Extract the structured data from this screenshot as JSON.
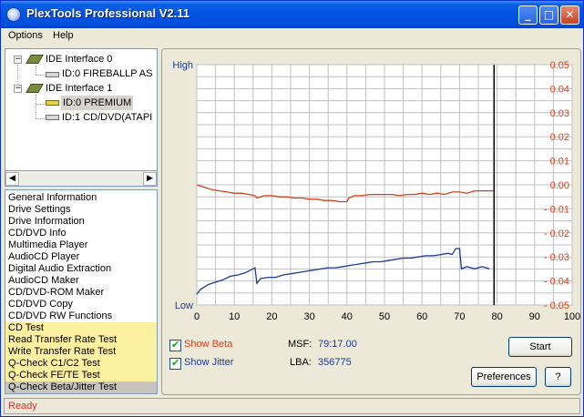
{
  "window": {
    "title": "PlexTools Professional V2.11",
    "minimize": "_",
    "maximize": "□",
    "close": "✕"
  },
  "menu": {
    "items": [
      "Options",
      "Help"
    ]
  },
  "tree": {
    "interfaces": [
      {
        "label": "IDE Interface 0",
        "expander": "−",
        "devices": [
          {
            "label": "ID:0  FIREBALLP AS"
          }
        ]
      },
      {
        "label": "IDE Interface 1",
        "expander": "−",
        "devices": [
          {
            "label": "ID:0  PREMIUM",
            "selected": true
          },
          {
            "label": "ID:1  CD/DVD(ATAPI"
          }
        ]
      }
    ],
    "scroll_left": "◀",
    "scroll_right": "▶"
  },
  "functions": {
    "items": [
      "General Information",
      "Drive Settings",
      "Drive Information",
      "CD/DVD Info",
      "Multimedia Player",
      "AudioCD Player",
      "Digital Audio Extraction",
      "AudioCD Maker",
      "CD/DVD-ROM Maker",
      "CD/DVD Copy",
      "CD/DVD RW Functions",
      "CD Test",
      "Read Transfer Rate Test",
      "Write Transfer Rate Test",
      "Q-Check C1/C2 Test",
      "Q-Check FE/TE Test",
      "Q-Check Beta/Jitter Test"
    ],
    "highlighted_from": 11,
    "selected_index": 16
  },
  "chart_data": {
    "type": "line",
    "left_axis": {
      "top_label": "High",
      "bottom_label": "Low"
    },
    "x_ticks": [
      0,
      10,
      20,
      30,
      40,
      50,
      60,
      70,
      80,
      90,
      100
    ],
    "xlim": [
      0,
      100
    ],
    "right_ticks": [
      "0.05",
      "0.04",
      "0.03",
      "0.02",
      "0.01",
      "0.00",
      "- 0.01",
      "- 0.02",
      "- 0.03",
      "- 0.04",
      "- 0.05"
    ],
    "ylim": [
      -0.05,
      0.05
    ],
    "marker_x": 79.2,
    "grid": true,
    "series": [
      {
        "color": "#d4401a",
        "x": [
          0,
          2,
          4,
          6,
          8,
          10,
          12,
          14,
          15.5,
          16,
          18,
          20,
          22,
          24,
          26,
          28,
          30,
          32,
          34,
          36,
          38,
          40,
          40.5,
          42,
          44,
          46,
          48,
          50,
          52,
          54,
          56,
          58,
          60,
          62,
          64,
          66,
          68,
          70,
          72,
          74,
          76,
          78,
          79.2
        ],
        "values": [
          0.0,
          -0.001,
          -0.002,
          -0.0025,
          -0.003,
          -0.0035,
          -0.0035,
          -0.004,
          -0.0045,
          -0.0055,
          -0.0045,
          -0.0045,
          -0.005,
          -0.005,
          -0.0055,
          -0.0055,
          -0.006,
          -0.006,
          -0.0065,
          -0.0065,
          -0.007,
          -0.007,
          -0.0055,
          -0.0045,
          -0.0045,
          -0.004,
          -0.004,
          -0.004,
          -0.004,
          -0.0045,
          -0.004,
          -0.004,
          -0.0035,
          -0.004,
          -0.0035,
          -0.004,
          -0.003,
          -0.003,
          -0.0035,
          -0.0025,
          -0.0025,
          -0.0025,
          -0.0025
        ]
      },
      {
        "color": "#1f3a93",
        "x": [
          0,
          1,
          3,
          5,
          7,
          9,
          11,
          13,
          15.5,
          16,
          17,
          19,
          21,
          23,
          25,
          27,
          29,
          31,
          33,
          35,
          37,
          39,
          41,
          43,
          45,
          47,
          49,
          51,
          53,
          55,
          57,
          59,
          61,
          63,
          65,
          67,
          68,
          69,
          70,
          70.5,
          72,
          74,
          76,
          78
        ],
        "values": [
          -0.0455,
          -0.0435,
          -0.0415,
          -0.0405,
          -0.0395,
          -0.038,
          -0.0375,
          -0.0365,
          -0.0345,
          -0.041,
          -0.039,
          -0.0385,
          -0.0385,
          -0.0375,
          -0.037,
          -0.0365,
          -0.036,
          -0.0355,
          -0.035,
          -0.0345,
          -0.0345,
          -0.034,
          -0.0335,
          -0.033,
          -0.0325,
          -0.032,
          -0.032,
          -0.0315,
          -0.031,
          -0.0305,
          -0.0305,
          -0.03,
          -0.0295,
          -0.0295,
          -0.029,
          -0.0285,
          -0.029,
          -0.0265,
          -0.0265,
          -0.035,
          -0.034,
          -0.035,
          -0.034,
          -0.035
        ]
      }
    ]
  },
  "controls": {
    "show_beta": {
      "label": "Show Beta",
      "checked": true,
      "color": "#d4401a"
    },
    "show_jitter": {
      "label": "Show Jitter",
      "checked": true,
      "color": "#1f3a93"
    },
    "msf_label": "MSF:",
    "msf_value": "79:17.00",
    "lba_label": "LBA:",
    "lba_value": "356775",
    "start_label": "Start",
    "preferences_label": "Preferences",
    "help_label": "?"
  },
  "status": {
    "text": "Ready"
  }
}
